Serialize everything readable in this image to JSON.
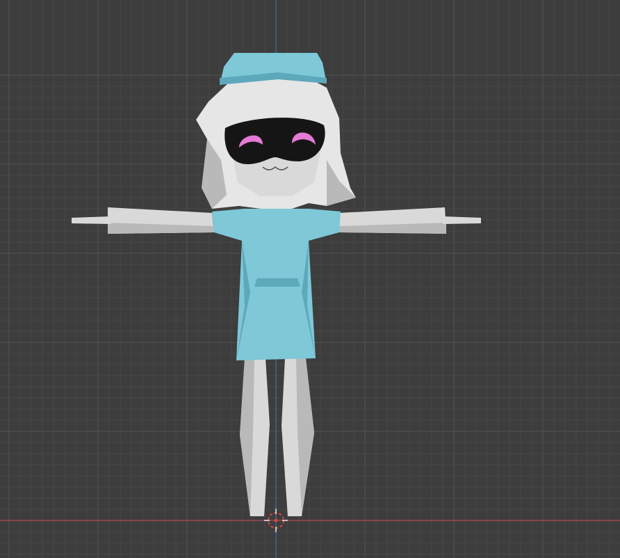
{
  "viewport": {
    "background": "#3d3d3d",
    "grid_minor_color": "#474747",
    "grid_major_color": "#535353",
    "axis_x_color": "#b34a55",
    "axis_z_color": "#3f6fb0"
  },
  "model": {
    "outfit_color": "#7ec8d8",
    "outfit_shadow_color": "#5ea8bb",
    "skin_color": "#d9d9d9",
    "skin_shadow_color": "#b9b9b9",
    "hair_color": "#e6e6e6",
    "visor_color": "#151515",
    "eye_color": "#e27ad6",
    "eye_highlight_color": "#f2b4ea"
  },
  "cursor": {
    "icon": "3d-cursor-icon",
    "ring_color": "#e8e8e8",
    "accent_color": "#d24a3c"
  }
}
